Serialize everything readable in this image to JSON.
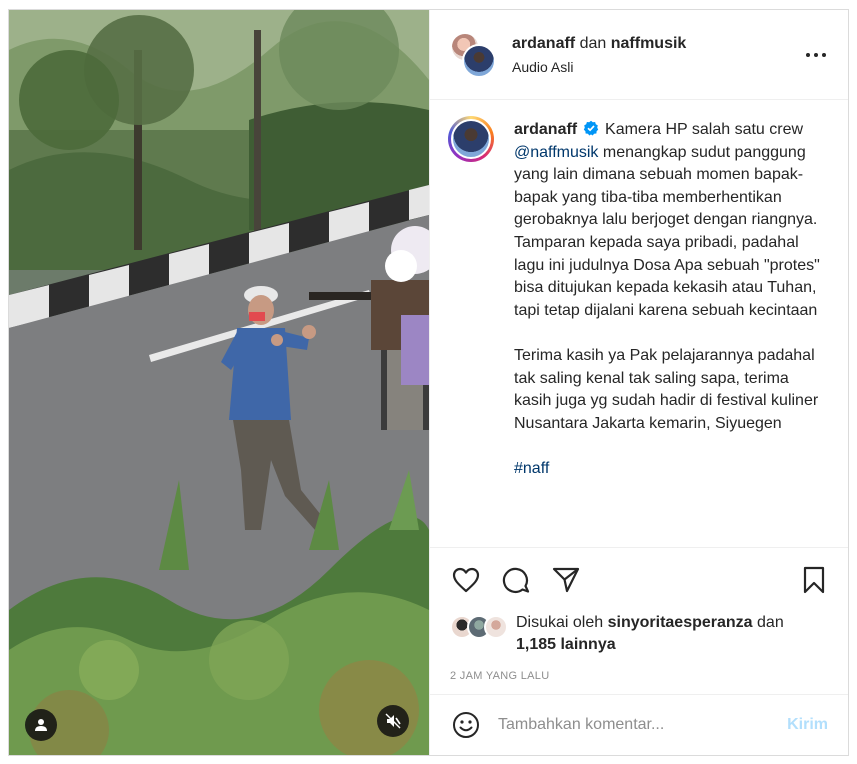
{
  "header": {
    "user1": "ardanaff",
    "joiner": "dan",
    "user2": "naffmusik",
    "audio": "Audio Asli",
    "more_icon": "more-horizontal-icon"
  },
  "caption": {
    "username": "ardanaff",
    "verified_icon": "verified-badge-icon",
    "text_a": "Kamera HP salah satu crew",
    "mention": "@naffmusik",
    "text_b": "menangkap sudut panggung yang lain dimana sebuah momen bapak-bapak yang tiba-tiba memberhentikan gerobaknya lalu berjoget dengan riangnya. Tamparan kepada saya pribadi, padahal lagu ini judulnya Dosa Apa sebuah \"protes\" bisa ditujukan kepada kekasih atau Tuhan, tapi tetap dijalani karena sebuah kecintaan",
    "paragraph2": "Terima kasih ya Pak pelajarannya padahal tak saling kenal tak saling sapa, terima kasih juga yg sudah hadir di festival kuliner Nusantara Jakarta kemarin, Siyuegen",
    "hashtag": "#naff"
  },
  "actions": {
    "like_icon": "heart-icon",
    "comment_icon": "comment-icon",
    "share_icon": "share-icon",
    "save_icon": "bookmark-icon"
  },
  "likes": {
    "prefix": "Disukai oleh",
    "user": "sinyoritaesperanza",
    "joiner": "dan",
    "count": "1,185 lainnya"
  },
  "timestamp": "2 JAM YANG LALU",
  "comment": {
    "emoji_icon": "emoji-icon",
    "placeholder": "Tambahkan komentar...",
    "post_label": "Kirim"
  },
  "media": {
    "tag_icon": "user-tag-icon",
    "mute_icon": "muted-speaker-icon"
  },
  "colors": {
    "link": "#00376b",
    "verified": "#0095f6",
    "post_disabled": "#b2dffc",
    "muted_text": "#8e8e8e"
  }
}
